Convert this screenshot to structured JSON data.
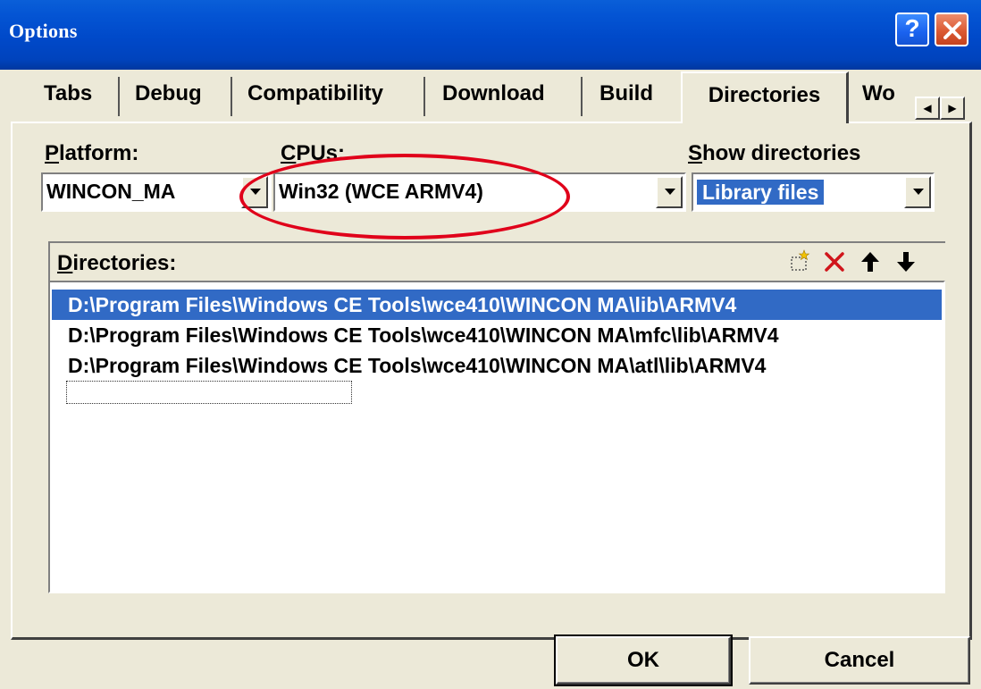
{
  "window": {
    "title": "Options"
  },
  "tabs": [
    {
      "label": "Tabs"
    },
    {
      "label": "Debug"
    },
    {
      "label": "Compatibility"
    },
    {
      "label": "Download"
    },
    {
      "label": "Build"
    },
    {
      "label": "Directories",
      "active": true
    },
    {
      "label": "Wo"
    }
  ],
  "platform": {
    "label_access": "P",
    "label_rest": "latform:",
    "value": "WINCON_MA"
  },
  "cpus": {
    "label_access": "C",
    "label_rest": "PUs:",
    "value": "Win32 (WCE ARMV4)"
  },
  "show_directories": {
    "label_access": "S",
    "label_rest": "how directories",
    "value": "Library files"
  },
  "directories": {
    "label_access": "D",
    "label_rest": "irectories:",
    "items": [
      "D:\\Program Files\\Windows CE Tools\\wce410\\WINCON  MA\\lib\\ARMV4",
      "D:\\Program Files\\Windows CE Tools\\wce410\\WINCON  MA\\mfc\\lib\\ARMV4",
      "D:\\Program Files\\Windows CE Tools\\wce410\\WINCON  MA\\atl\\lib\\ARMV4"
    ],
    "selected_index": 0
  },
  "buttons": {
    "ok": "OK",
    "cancel": "Cancel"
  },
  "colors": {
    "title_bar": "#0054e3",
    "selection": "#316ac5",
    "annotation": "#e0001a",
    "face": "#ece9d8"
  }
}
